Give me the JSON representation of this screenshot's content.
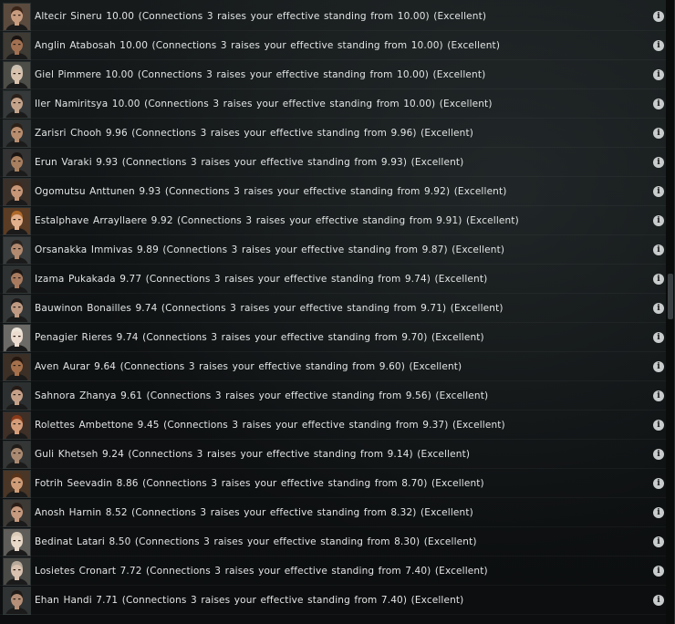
{
  "rows": [
    {
      "text": "Altecir Sineru 10.00 (Connections 3 raises your effective standing from 10.00) (Excellent)",
      "skin": "#c89c7e",
      "hair": "#3a2418",
      "bg": "#5b4a3e"
    },
    {
      "text": "Anglin Atabosah 10.00 (Connections 3 raises your effective standing from 10.00) (Excellent)",
      "skin": "#a27152",
      "hair": "#181210",
      "bg": "#3e3a34"
    },
    {
      "text": "Giel Pimmere 10.00 (Connections 3 raises your effective standing from 10.00) (Excellent)",
      "skin": "#d8c2ad",
      "hair": "#c9c0b2",
      "bg": "#4d4d48"
    },
    {
      "text": "Iler Namiritsya 10.00 (Connections 3 raises your effective standing from 10.00) (Excellent)",
      "skin": "#c4a38b",
      "hair": "#2a1f18",
      "bg": "#35393a"
    },
    {
      "text": "Zarisri Chooh 9.96 (Connections 3 raises your effective standing from 9.96) (Excellent)",
      "skin": "#b88e6f",
      "hair": "#2d2017",
      "bg": "#2f3333"
    },
    {
      "text": "Erun Varaki 9.93 (Connections 3 raises your effective standing from 9.93) (Excellent)",
      "skin": "#a8805f",
      "hair": "#1b1512",
      "bg": "#333"
    },
    {
      "text": "Ogomutsu Anttunen 9.93 (Connections 3 raises your effective standing from 9.92) (Excellent)",
      "skin": "#c79677",
      "hair": "#402a1c",
      "bg": "#3a302a"
    },
    {
      "text": "Estalphave Arrayllaere 9.92 (Connections 3 raises your effective standing from 9.91) (Excellent)",
      "skin": "#e3b08c",
      "hair": "#b06a2a",
      "bg": "#5b3c24"
    },
    {
      "text": "Orsanakka Immivas 9.89 (Connections 3 raises your effective standing from 9.87) (Excellent)",
      "skin": "#b28a70",
      "hair": "#2b2521",
      "bg": "#3a3d3d"
    },
    {
      "text": "Izama Pukakada 9.77 (Connections 3 raises your effective standing from 9.74) (Excellent)",
      "skin": "#a87b5f",
      "hair": "#1e1714",
      "bg": "#2f3232"
    },
    {
      "text": "Bauwinon Bonailles 9.74 (Connections 3 raises your effective standing from 9.71) (Excellent)",
      "skin": "#bf9a83",
      "hair": "#1c1a19",
      "bg": "#343737"
    },
    {
      "text": "Penagier Rieres 9.74 (Connections 3 raises your effective standing from 9.70) (Excellent)",
      "skin": "#ecdccf",
      "hair": "#efe6da",
      "bg": "#6c6a66"
    },
    {
      "text": "Aven Aurar 9.64 (Connections 3 raises your effective standing from 9.60) (Excellent)",
      "skin": "#a5704b",
      "hair": "#24160e",
      "bg": "#3b2f26"
    },
    {
      "text": "Sahnora Zhanya 9.61 (Connections 3 raises your effective standing from 9.56) (Excellent)",
      "skin": "#c5a089",
      "hair": "#241a15",
      "bg": "#2d3030"
    },
    {
      "text": "Rolettes Ambettone 9.45 (Connections 3 raises your effective standing from 9.37) (Excellent)",
      "skin": "#d59d79",
      "hair": "#8a3b1a",
      "bg": "#3e2f27"
    },
    {
      "text": "Guli Khetseh 9.24 (Connections 3 raises your effective standing from 9.14) (Excellent)",
      "skin": "#ab8a72",
      "hair": "#1f1b18",
      "bg": "#343636"
    },
    {
      "text": "Fotrih Seevadin 8.86 (Connections 3 raises your effective standing from 8.70) (Excellent)",
      "skin": "#cf9c77",
      "hair": "#5a3318",
      "bg": "#4a3626"
    },
    {
      "text": "Anosh Harnin 8.52 (Connections 3 raises your effective standing from 8.32) (Excellent)",
      "skin": "#c69a7e",
      "hair": "#2b1e16",
      "bg": "#3d3a36"
    },
    {
      "text": "Bedinat Latari 8.50 (Connections 3 raises your effective standing from 8.30) (Excellent)",
      "skin": "#e8d8c8",
      "hair": "#d9cbb8",
      "bg": "#5f5d59"
    },
    {
      "text": "Losietes Cronart 7.72 (Connections 3 raises your effective standing from 7.40) (Excellent)",
      "skin": "#d9c2b0",
      "hair": "#b6a99a",
      "bg": "#4a4a47"
    },
    {
      "text": "Ehan Handi 7.71 (Connections 3 raises your effective standing from 7.40) (Excellent)",
      "skin": "#b58f77",
      "hair": "#1f1a17",
      "bg": "#303333"
    }
  ],
  "info_label": "i",
  "icons": {
    "info": "info-icon",
    "portrait": "portrait-icon"
  }
}
